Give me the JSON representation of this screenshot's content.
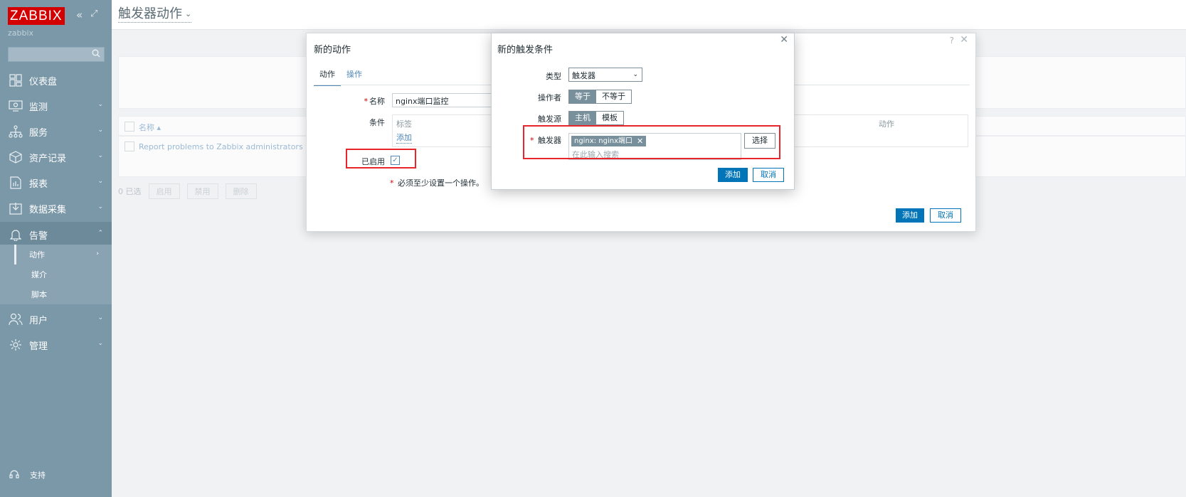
{
  "sidebar": {
    "logo": "ZABBIX",
    "server_name": "zabbix",
    "search_placeholder": "",
    "menu": [
      {
        "label": "仪表盘",
        "icon": "dashboard-icon"
      },
      {
        "label": "监测",
        "icon": "monitoring-icon"
      },
      {
        "label": "服务",
        "icon": "services-icon"
      },
      {
        "label": "资产记录",
        "icon": "inventory-icon"
      },
      {
        "label": "报表",
        "icon": "reports-icon"
      },
      {
        "label": "数据采集",
        "icon": "data-collection-icon"
      },
      {
        "label": "告警",
        "icon": "alerts-icon"
      },
      {
        "label": "用户",
        "icon": "users-icon"
      },
      {
        "label": "管理",
        "icon": "administration-icon"
      }
    ],
    "alerts_submenu": [
      "动作",
      "媒介",
      "脚本"
    ],
    "support": "支持"
  },
  "page": {
    "title": "触发器动作"
  },
  "list": {
    "column_name": "名称 ▴",
    "row": "Report problems to Zabbix administrators",
    "selected_count": "0 已选",
    "btn_enable": "启用",
    "btn_disable": "禁用",
    "btn_delete": "删除"
  },
  "action_dialog": {
    "title": "新的动作",
    "help": "?",
    "tabs": [
      "动作",
      "操作"
    ],
    "name_label": "名称",
    "name_value": "nginx端口监控",
    "conditions_label": "条件",
    "cond_col_label": "标签",
    "cond_col_action": "动作",
    "cond_add": "添加",
    "enabled_label": "已启用",
    "must_note": "必须至少设置一个操作。",
    "btn_add": "添加",
    "btn_cancel": "取消"
  },
  "condition_dialog": {
    "title": "新的触发条件",
    "type_label": "类型",
    "type_value": "触发器",
    "operator_label": "操作者",
    "operator_options": [
      "等于",
      "不等于"
    ],
    "operator_selected": "等于",
    "source_label": "触发源",
    "source_options": [
      "主机",
      "模板"
    ],
    "source_selected": "主机",
    "trigger_label": "触发器",
    "trigger_tag": "nginx: nginx端口",
    "trigger_placeholder": "在此输入搜索",
    "btn_select": "选择",
    "btn_add": "添加",
    "btn_cancel": "取消"
  },
  "colors": {
    "sidebar_bg": "#7b98a8",
    "accent": "#0275b8",
    "logo_red": "#d40000",
    "highlight_red": "#e8252a"
  }
}
